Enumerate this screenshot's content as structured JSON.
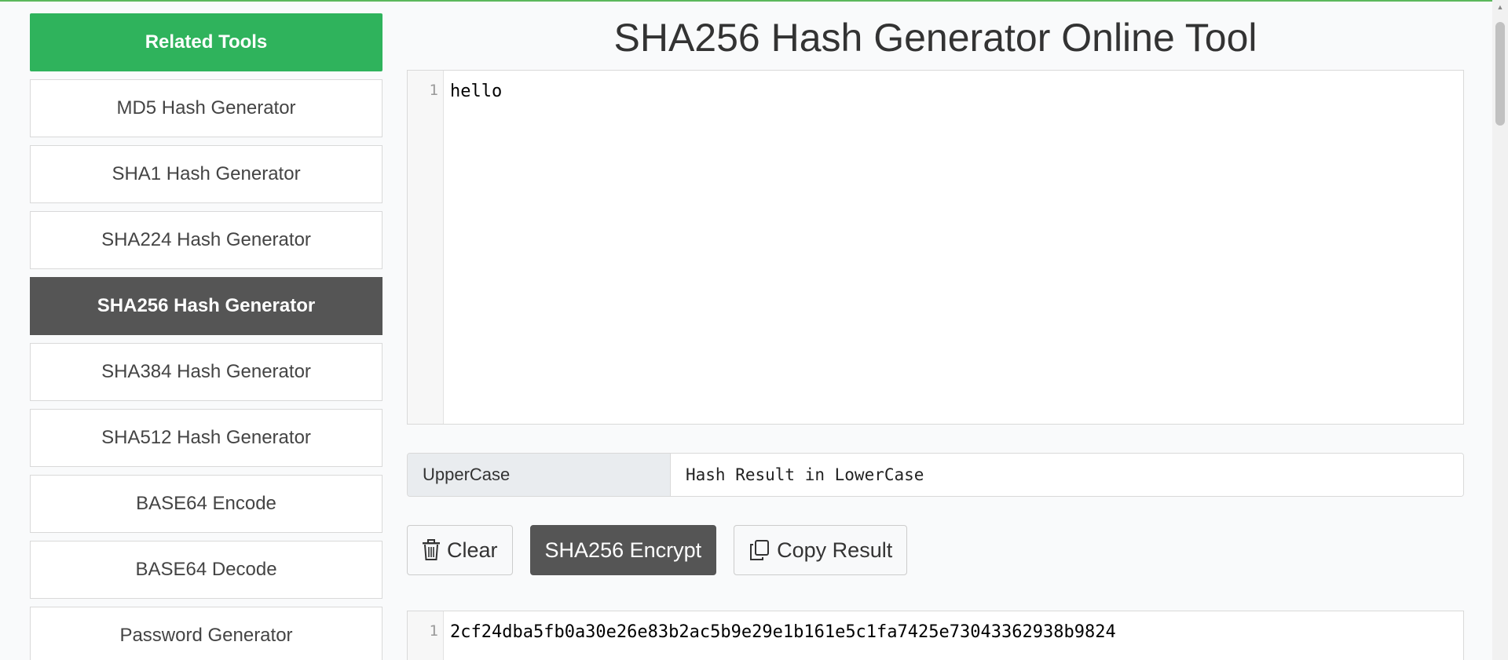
{
  "sidebar": {
    "header": "Related Tools",
    "items": [
      {
        "label": "MD5 Hash Generator",
        "active": false
      },
      {
        "label": "SHA1 Hash Generator",
        "active": false
      },
      {
        "label": "SHA224 Hash Generator",
        "active": false
      },
      {
        "label": "SHA256 Hash Generator",
        "active": true
      },
      {
        "label": "SHA384 Hash Generator",
        "active": false
      },
      {
        "label": "SHA512 Hash Generator",
        "active": false
      },
      {
        "label": "BASE64 Encode",
        "active": false
      },
      {
        "label": "BASE64 Decode",
        "active": false
      },
      {
        "label": "Password Generator",
        "active": false
      }
    ]
  },
  "main": {
    "title": "SHA256 Hash Generator Online Tool",
    "input_editor": {
      "line_number": "1",
      "content": "hello"
    },
    "case_option": {
      "label": "UpperCase",
      "value": "Hash Result in LowerCase"
    },
    "buttons": {
      "clear": "Clear",
      "encrypt": "SHA256 Encrypt",
      "copy": "Copy Result"
    },
    "output_editor": {
      "line_number": "1",
      "content": "2cf24dba5fb0a30e26e83b2ac5b9e29e1b161e5c1fa7425e73043362938b9824"
    }
  },
  "colors": {
    "accent_green": "#2fb35c",
    "active_dark": "#555555"
  },
  "icons": {
    "clear": "trash-icon",
    "copy": "copy-icon"
  }
}
